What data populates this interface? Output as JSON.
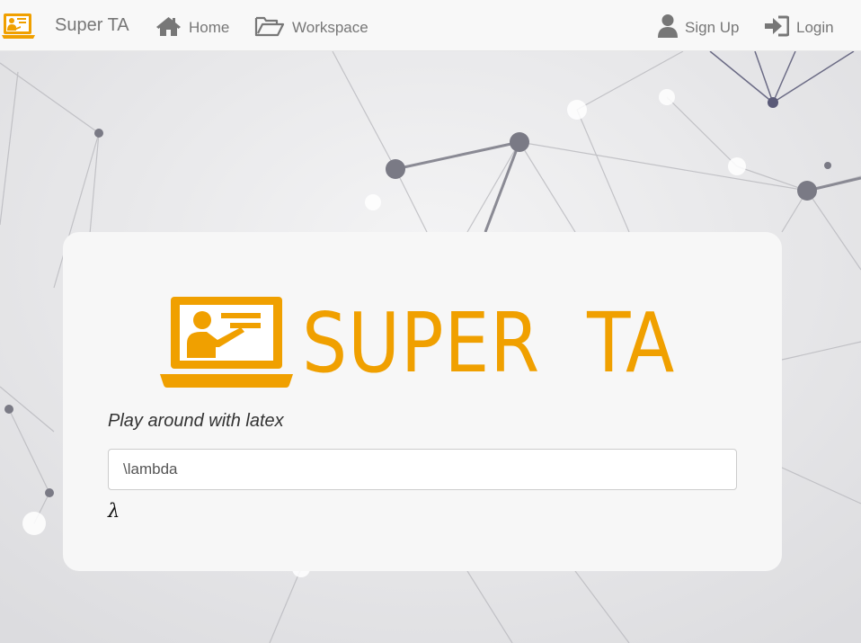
{
  "navbar": {
    "brand": "Super TA",
    "links": [
      {
        "label": "Home",
        "icon": "home-icon"
      },
      {
        "label": "Workspace",
        "icon": "folder-open-icon"
      }
    ],
    "right_links": [
      {
        "label": "Sign Up",
        "icon": "user-icon"
      },
      {
        "label": "Login",
        "icon": "sign-in-icon"
      }
    ]
  },
  "hero": {
    "logo_icon": "teacher-laptop-icon",
    "title": "SUPER  TA"
  },
  "latex": {
    "prompt": "Play around with latex",
    "input_value": "\\lambda",
    "rendered_output": "λ"
  },
  "colors": {
    "brand": "#f0a000",
    "nav_text": "#777777",
    "nav_bg": "#f8f8f8"
  }
}
